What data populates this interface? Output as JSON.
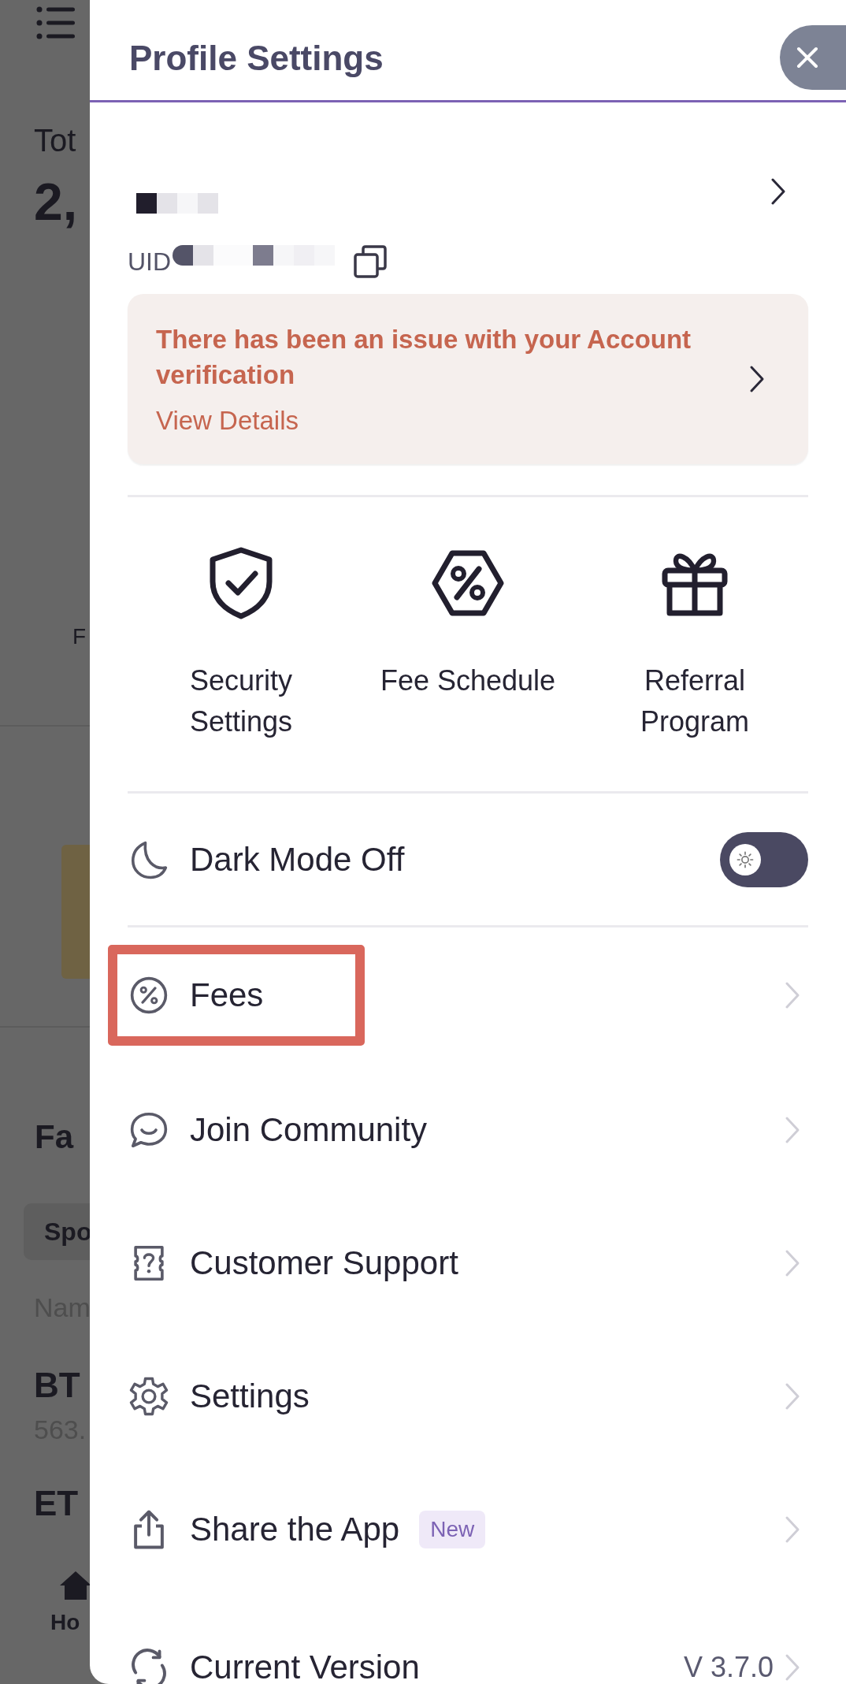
{
  "background_page": {
    "balance_label": "Tot",
    "balance_value": "2,",
    "shortcut_label": "F",
    "favorites_title": "Fa",
    "favorites_tab": "Spo",
    "column_header": "Nam",
    "coins": [
      {
        "symbol": "BT",
        "price": "563."
      },
      {
        "symbol": "ET"
      }
    ],
    "nav": {
      "label": "Ho"
    }
  },
  "drawer": {
    "title": "Profile Settings",
    "profile": {
      "uid_label": "UID"
    },
    "alert": {
      "message": "There has been an issue with your Account verification",
      "link": "View Details"
    },
    "quick_actions": [
      {
        "kind": "shield",
        "label": "Security Settings"
      },
      {
        "kind": "percent",
        "label": "Fee Schedule"
      },
      {
        "kind": "gift",
        "label": "Referral Program"
      }
    ],
    "dark_mode": {
      "label": "Dark Mode Off",
      "on": false
    },
    "menu": [
      {
        "kind": "percent",
        "label": "Fees",
        "highlighted": true
      },
      {
        "kind": "chat",
        "label": "Join Community",
        "highlighted": false
      },
      {
        "kind": "support",
        "label": "Customer Support",
        "highlighted": false
      },
      {
        "kind": "gear",
        "label": "Settings",
        "highlighted": false
      },
      {
        "kind": "share",
        "label": "Share the App",
        "badge": "New",
        "highlighted": false
      },
      {
        "kind": "refresh",
        "label": "Current Version",
        "value": "V 3.7.0",
        "highlighted": false
      }
    ]
  }
}
